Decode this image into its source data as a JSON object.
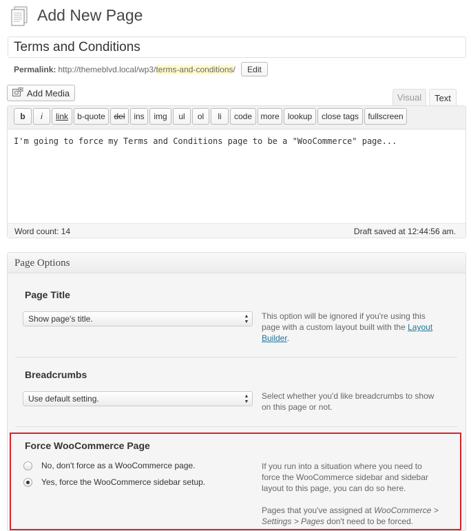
{
  "header": {
    "title": "Add New Page"
  },
  "post": {
    "title_value": "Terms and Conditions",
    "permalink_label": "Permalink:",
    "permalink_base": "http://themeblvd.local/wp3/",
    "permalink_slug": "terms-and-conditions",
    "permalink_end": "/",
    "edit_label": "Edit"
  },
  "editor": {
    "add_media_label": "Add Media",
    "tabs": [
      "Visual",
      "Text"
    ],
    "quicktags": [
      "b",
      "i",
      "link",
      "b-quote",
      "del",
      "ins",
      "img",
      "ul",
      "ol",
      "li",
      "code",
      "more",
      "lookup",
      "close tags",
      "fullscreen"
    ],
    "content": "I'm going to force my Terms and Conditions page to be a \"WooCommerce\" page...",
    "word_count": "Word count: 14",
    "draft_saved": "Draft saved at 12:44:56 am."
  },
  "page_options": {
    "title": "Page Options",
    "page_title": {
      "heading": "Page Title",
      "selected": "Show page's title.",
      "desc_1": "This option will be ignored if you're using this page with a custom layout built with the",
      "desc_link": "Layout Builder",
      "desc_end": "."
    },
    "breadcrumbs": {
      "heading": "Breadcrumbs",
      "selected": "Use default setting.",
      "desc": "Select whether you'd like breadcrumbs to show on this page or not."
    },
    "force_woo": {
      "heading": "Force WooCommerce Page",
      "options": [
        {
          "label": "No, don't force as a WooCommerce page.",
          "checked": false
        },
        {
          "label": "Yes, force the WooCommerce sidebar setup.",
          "checked": true
        }
      ],
      "desc_1": "If you run into a situation where you need to force the WooCommerce sidebar and sidebar layout to this page, you can do so here.",
      "desc_2_a": "Pages that you've assigned at ",
      "desc_2_em": "WooCommerce > Settings > Pages",
      "desc_2_b": " don't need to be forced."
    }
  },
  "colors": {
    "highlight_border": "#d9232b",
    "link": "#21759b",
    "slug_bg": "#fffbcc"
  },
  "icons": {
    "page_icon": "pages-icon",
    "media_icon": "media-icon"
  }
}
